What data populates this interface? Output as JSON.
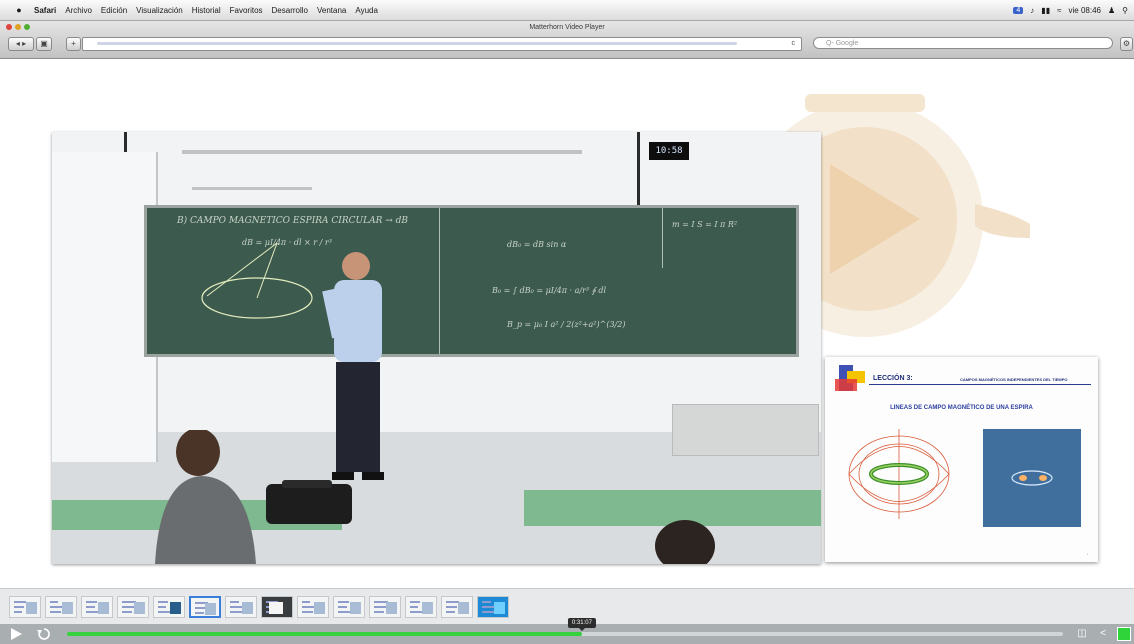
{
  "menubar": {
    "apple_icon": "apple-icon",
    "app_name": "Safari",
    "items": [
      "Archivo",
      "Edición",
      "Visualización",
      "Historial",
      "Favoritos",
      "Desarrollo",
      "Ventana",
      "Ayuda"
    ],
    "status_badge": "4",
    "clock": "vie 08:46"
  },
  "window": {
    "title": "Matterhorn Video Player",
    "address_placeholder": "",
    "reload_label": "c",
    "search_placeholder": "Q- Google",
    "add_label": "+",
    "nav_label": "◂ ▸"
  },
  "video": {
    "clock_display": "10:58",
    "board_formulas": [
      "B) CAMPO MAGNETICO ESPIRA CIRCULAR  → dB",
      "dB = μI/4π · dl × r / r³",
      "dB₀ = dB sin α",
      "B₀ = ∫ dB₀ = μI/4π · a/r³ ∮ dl",
      "m = I S = I π R²",
      "B_p = μ₀ I a² / 2(z²+a²)^(3/2)"
    ]
  },
  "slide": {
    "lesson": "LECCIÓN 3:",
    "subtitle": "CAMPOS MAGNÉTICOS INDEPENDIENTES DEL TIEMPO",
    "heading": "LINEAS DE CAMPO MAGNÉTICO DE UNA ESPIRA"
  },
  "player": {
    "thumbnail_count": 14,
    "active_thumbnail": 6,
    "progress_fraction": 0.517,
    "time_tooltip": "0:31:07",
    "play_icon": "play-icon",
    "replay_icon": "replay-icon",
    "layout_icon": "layout-icon",
    "share_icon": "share-icon",
    "fullscreen_icon": "fullscreen-icon",
    "accent_color": "#36d23d"
  }
}
